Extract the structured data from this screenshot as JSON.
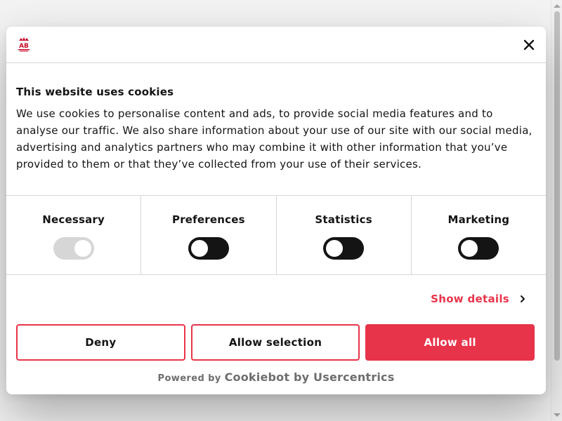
{
  "dialog": {
    "logo_text": "AB",
    "close_label": "Close",
    "title": "This website uses cookies",
    "description": "We use cookies to personalise content and ads, to provide social media features and to analyse our traffic. We also share information about your use of our site with our social media, advertising and analytics partners who may combine it with other information that you’ve provided to them or that they’ve collected from your use of their services.",
    "categories": [
      {
        "label": "Necessary",
        "enabled": true,
        "disabled": true
      },
      {
        "label": "Preferences",
        "enabled": false,
        "disabled": false
      },
      {
        "label": "Statistics",
        "enabled": false,
        "disabled": false
      },
      {
        "label": "Marketing",
        "enabled": false,
        "disabled": false
      }
    ],
    "show_details": "Show details",
    "buttons": {
      "deny": "Deny",
      "allow_selection": "Allow selection",
      "allow_all": "Allow all"
    },
    "powered_by": "Powered by",
    "powered_brand": "Cookiebot by Usercentrics"
  },
  "colors": {
    "accent": "#e8344a",
    "toggle_off": "#141414",
    "toggle_disabled": "#d6d6d6"
  }
}
